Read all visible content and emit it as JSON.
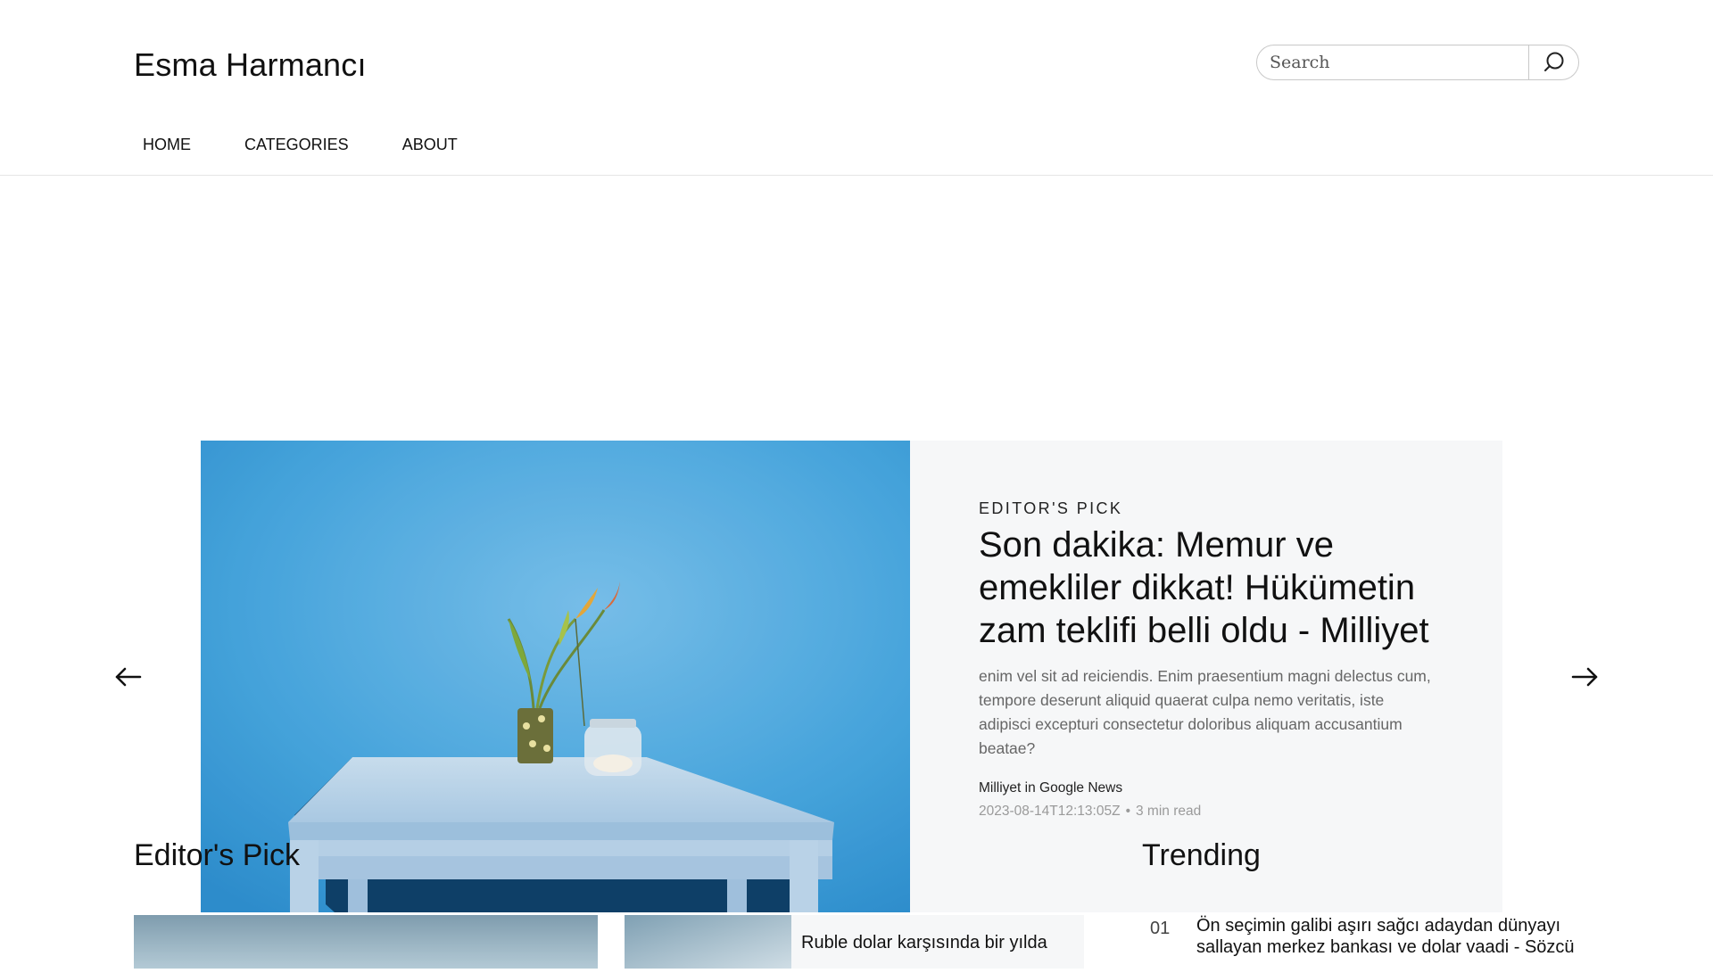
{
  "header": {
    "site_title": "Esma Harmancı",
    "search_placeholder": "Search",
    "nav": [
      "HOME",
      "CATEGORIES",
      "ABOUT"
    ]
  },
  "hero": {
    "kicker": "EDITOR'S PICK",
    "title": "Son dakika: Memur ve emekliler dikkat! Hükümetin zam teklifi belli oldu - Milliyet",
    "excerpt": "enim vel sit ad reiciendis. Enim praesentium magni delectus cum, tempore deserunt aliquid quaerat culpa nemo veritatis, iste adipisci excepturi consectetur doloribus aliquam accusantium beatae?",
    "source": "Milliyet in Google News",
    "date": "2023-08-14T12:13:05Z",
    "separator": "•",
    "read_time": "3 min read"
  },
  "editors_pick": {
    "heading": "Editor's Pick",
    "cards": [
      {
        "title": ""
      },
      {
        "title": "Ruble dolar karşısında bir yılda"
      }
    ]
  },
  "trending": {
    "heading": "Trending",
    "items": [
      {
        "num": "01",
        "title": "Ön seçimin galibi aşırı sağcı adaydan dünyayı sallayan merkez bankası ve dolar vaadi - Sözcü"
      }
    ]
  },
  "colors": {
    "hero_bg": "#f6f7f8",
    "wall_blue": "#4aa8e0",
    "muted_text": "#666666",
    "meta_text": "#9a9a9a"
  },
  "icons": {
    "search": "search-icon",
    "prev": "arrow-left-icon",
    "next": "arrow-right-icon"
  }
}
